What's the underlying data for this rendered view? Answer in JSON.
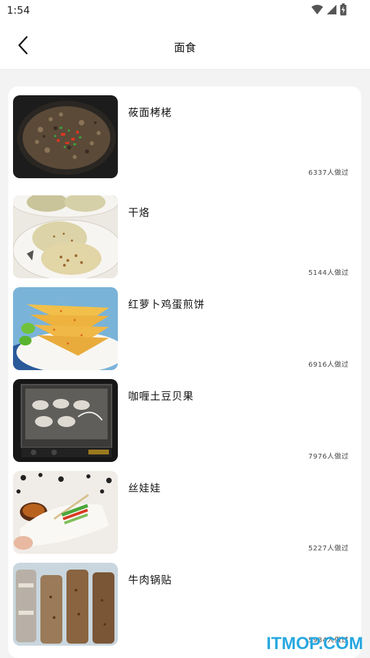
{
  "status_bar": {
    "time": "1:54"
  },
  "app_bar": {
    "title": "面食"
  },
  "recipes": [
    {
      "name": "莜面栲栳",
      "count": "6337人做过"
    },
    {
      "name": "干烙",
      "count": "5144人做过"
    },
    {
      "name": "红萝卜鸡蛋煎饼",
      "count": "6916人做过"
    },
    {
      "name": "咖喱土豆贝果",
      "count": "7976人做过"
    },
    {
      "name": "丝娃娃",
      "count": "5227人做过"
    },
    {
      "name": "牛肉锅贴",
      "count": "5984人做过"
    }
  ],
  "watermark": "ITMOP.COM",
  "colors": {
    "accent": "#27a8e0",
    "background": "#f3f3f3",
    "card": "#ffffff"
  }
}
